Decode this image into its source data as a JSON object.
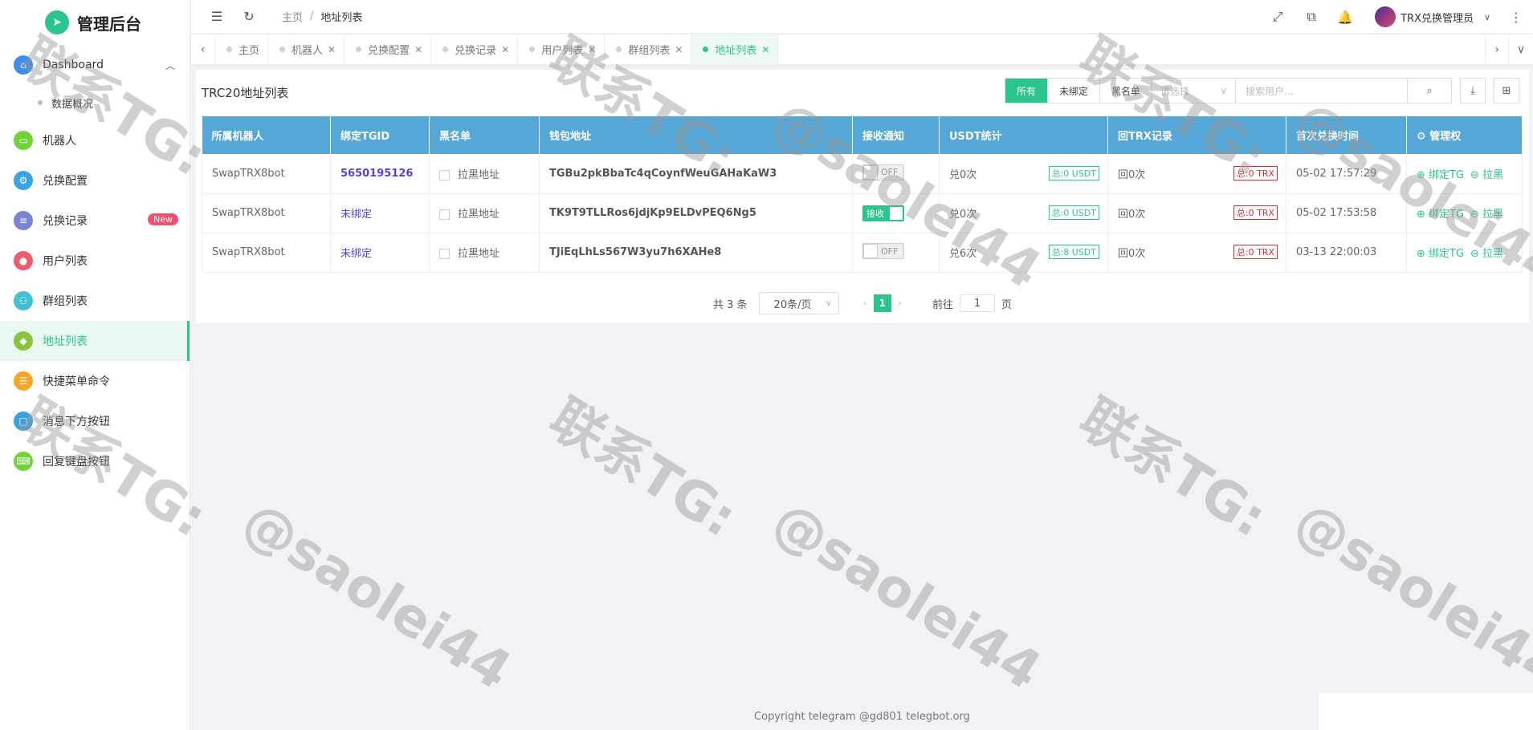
{
  "app": {
    "title": "管理后台"
  },
  "sidebar": {
    "items": [
      {
        "label": "Dashboard",
        "color": "#3d8ef0",
        "icon": "home-icon"
      },
      {
        "label": "数据概况"
      },
      {
        "label": "机器人",
        "color": "#6fd236",
        "icon": "monitor-icon"
      },
      {
        "label": "兑换配置",
        "color": "#3aa3e3",
        "icon": "settings-icon"
      },
      {
        "label": "兑换记录",
        "color": "#7a84d6",
        "icon": "document-icon",
        "badge": "New"
      },
      {
        "label": "用户列表",
        "color": "#f05a6b",
        "icon": "user-icon"
      },
      {
        "label": "群组列表",
        "color": "#3ec1d3",
        "icon": "group-icon"
      },
      {
        "label": "地址列表",
        "color": "#8ac43f",
        "icon": "cube-icon"
      },
      {
        "label": "快捷菜单命令",
        "color": "#f6a623",
        "icon": "sliders-icon"
      },
      {
        "label": "消息下方按钮",
        "color": "#3aa3e3",
        "icon": "button-icon"
      },
      {
        "label": "回复键盘按钮",
        "color": "#6fd236",
        "icon": "keyboard-icon"
      }
    ]
  },
  "header": {
    "breadcrumb": [
      "主页",
      "/",
      "地址列表"
    ],
    "user": "TRX兑换管理员"
  },
  "tabs": [
    {
      "label": "主页"
    },
    {
      "label": "机器人"
    },
    {
      "label": "兑换配置"
    },
    {
      "label": "兑换记录"
    },
    {
      "label": "用户列表"
    },
    {
      "label": "群组列表"
    },
    {
      "label": "地址列表"
    }
  ],
  "panel": {
    "title": "TRC20地址列表",
    "filters": [
      "所有",
      "未绑定",
      "黑名单"
    ],
    "select_placeholder": "请选择",
    "search_placeholder": "搜索用户..."
  },
  "table": {
    "headers": [
      "所属机器人",
      "绑定TGID",
      "黑名单",
      "钱包地址",
      "接收通知",
      "USDT统计",
      "回TRX记录",
      "首次兑换时间",
      "管理权"
    ],
    "rows": [
      {
        "bot": "SwapTRX8bot",
        "tgid": "5650195126",
        "black": "拉黑地址",
        "addr": "TGBu2pkBbaTc4qCoynfWeuGAHaKaW3",
        "notify": "OFF",
        "usdt_count": "兑0次",
        "usdt_total": "总:0 USDT",
        "trx_count": "回0次",
        "trx_total": "总:0 TRX",
        "time": "05-02 17:57:29",
        "op1": "绑定TG",
        "op2": "拉黑"
      },
      {
        "bot": "SwapTRX8bot",
        "tgid": "未绑定",
        "black": "拉黑地址",
        "addr": "TK9T9TLLRos6jdjKp9ELDvPEQ6Ng5",
        "notify": "接收",
        "usdt_count": "兑0次",
        "usdt_total": "总:0 USDT",
        "trx_count": "回0次",
        "trx_total": "总:0 TRX",
        "time": "05-02 17:53:58",
        "op1": "绑定TG",
        "op2": "拉黑"
      },
      {
        "bot": "SwapTRX8bot",
        "tgid": "未绑定",
        "black": "拉黑地址",
        "addr": "TJiEqLhLs567W3yu7h6XAHe8",
        "notify": "OFF",
        "usdt_count": "兑6次",
        "usdt_total": "总:8 USDT",
        "trx_count": "回0次",
        "trx_total": "总:0 TRX",
        "time": "03-13 22:00:03",
        "op1": "绑定TG",
        "op2": "拉黑"
      }
    ]
  },
  "pager": {
    "total": "共 3 条",
    "size": "20条/页",
    "page": "1",
    "goto": "前往",
    "goto_value": "1",
    "page_unit": "页"
  },
  "footer": "Copyright telegram @gd801 telegbot.org",
  "watermark": {
    "line1": "联系TG:",
    "line2": "@saolei44"
  }
}
